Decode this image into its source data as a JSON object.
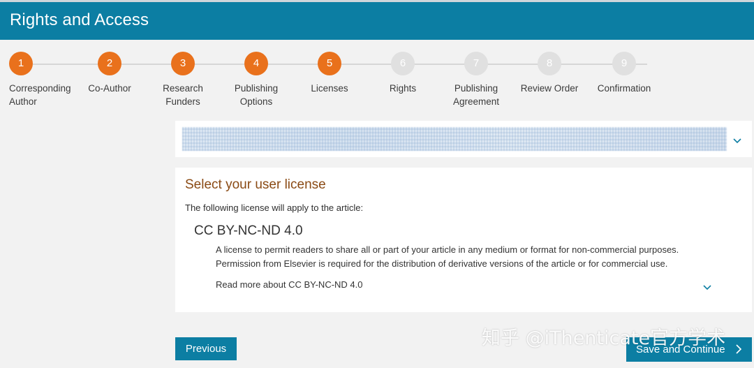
{
  "header": {
    "title": "Rights and Access"
  },
  "steps": [
    {
      "num": "1",
      "label": "Corresponding Author"
    },
    {
      "num": "2",
      "label": "Co-Author"
    },
    {
      "num": "3",
      "label": "Research Funders"
    },
    {
      "num": "4",
      "label": "Publishing Options"
    },
    {
      "num": "5",
      "label": "Licenses"
    },
    {
      "num": "6",
      "label": "Rights"
    },
    {
      "num": "7",
      "label": "Publishing Agreement"
    },
    {
      "num": "8",
      "label": "Review Order"
    },
    {
      "num": "9",
      "label": "Confirmation"
    }
  ],
  "current_step": 5,
  "license": {
    "heading": "Select your user license",
    "intro": "The following license will apply to the article:",
    "name": "CC BY-NC-ND 4.0",
    "desc_line1": "A license to permit readers to share all or part of your article in any medium or format for non-commercial purposes.",
    "desc_line2": "Permission from Elsevier is required for the distribution of derivative versions of the article or for commercial use.",
    "read_more": "Read more about CC BY-NC-ND 4.0"
  },
  "buttons": {
    "previous": "Previous",
    "save_continue": "Save and Continue"
  },
  "watermark": "知乎 @iThenticate官方学术",
  "colors": {
    "brand": "#0c7ea3",
    "step_done": "#e9711c",
    "step_todo": "#e0e0e0",
    "heading": "#8a4a14"
  }
}
